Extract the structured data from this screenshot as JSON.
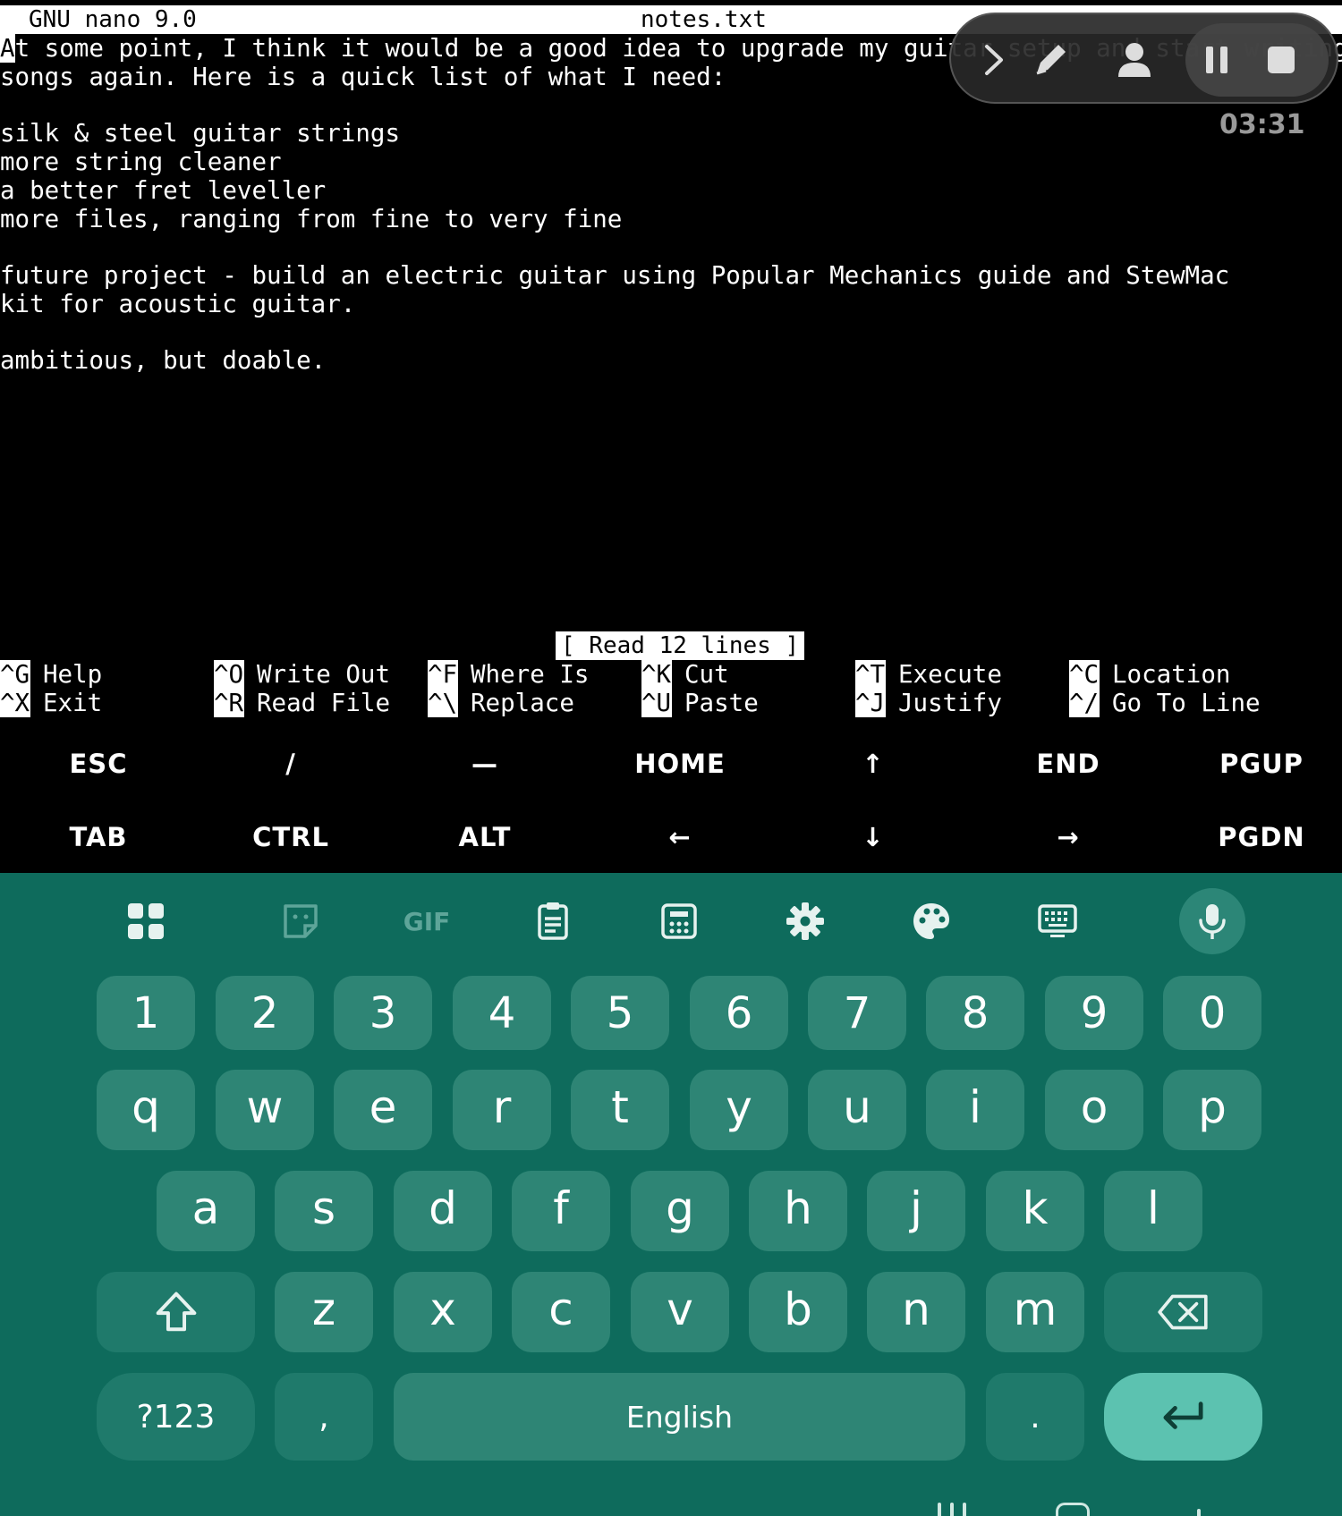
{
  "title_bar": {
    "app": "GNU nano 9.0",
    "filename": "notes.txt"
  },
  "editor": {
    "cursor_char": "A",
    "lines": [
      "t some point, I think it would be a good idea to upgrade my guitar setup and start writing",
      "songs again. Here is a quick list of what I need:",
      "",
      "silk & steel guitar strings",
      "more string cleaner",
      "a better fret leveller",
      "more files, ranging from fine to very fine",
      "",
      "future project - build an electric guitar using Popular Mechanics guide and StewMac",
      "kit for acoustic guitar.",
      "",
      "ambitious, but doable."
    ]
  },
  "status_message": "[ Read 12 lines ]",
  "shortcuts": [
    {
      "key": "^G",
      "label": "Help"
    },
    {
      "key": "^O",
      "label": "Write Out"
    },
    {
      "key": "^F",
      "label": "Where Is"
    },
    {
      "key": "^K",
      "label": "Cut"
    },
    {
      "key": "^T",
      "label": "Execute"
    },
    {
      "key": "^C",
      "label": "Location"
    },
    {
      "key": "^X",
      "label": "Exit"
    },
    {
      "key": "^R",
      "label": "Read File"
    },
    {
      "key": "^\\",
      "label": "Replace"
    },
    {
      "key": "^U",
      "label": "Paste"
    },
    {
      "key": "^J",
      "label": "Justify"
    },
    {
      "key": "^/",
      "label": "Go To Line"
    }
  ],
  "extra_keys": {
    "row1": [
      "ESC",
      "/",
      "—",
      "HOME",
      "↑",
      "END",
      "PGUP"
    ],
    "row2": [
      "TAB",
      "CTRL",
      "ALT",
      "←",
      "↓",
      "→",
      "PGDN"
    ]
  },
  "recorder": {
    "timer": "03:31"
  },
  "keyboard": {
    "toolbar_icons": [
      "apps-grid-icon",
      "sticker-icon",
      "gif-icon",
      "clipboard-icon",
      "numpad-icon",
      "settings-icon",
      "palette-icon",
      "keyboard-icon",
      "mic-icon"
    ],
    "gif_label": "GIF",
    "digits": [
      "1",
      "2",
      "3",
      "4",
      "5",
      "6",
      "7",
      "8",
      "9",
      "0"
    ],
    "row_q": [
      "q",
      "w",
      "e",
      "r",
      "t",
      "y",
      "u",
      "i",
      "o",
      "p"
    ],
    "row_a": [
      "a",
      "s",
      "d",
      "f",
      "g",
      "h",
      "j",
      "k",
      "l"
    ],
    "row_z": [
      "z",
      "x",
      "c",
      "v",
      "b",
      "n",
      "m"
    ],
    "symbols_label": "?123",
    "comma": ",",
    "space_label": "English",
    "period": ".",
    "colors": {
      "background": "#0e6b5c",
      "key": "#2e8575",
      "enter": "#5cc2b0"
    }
  }
}
